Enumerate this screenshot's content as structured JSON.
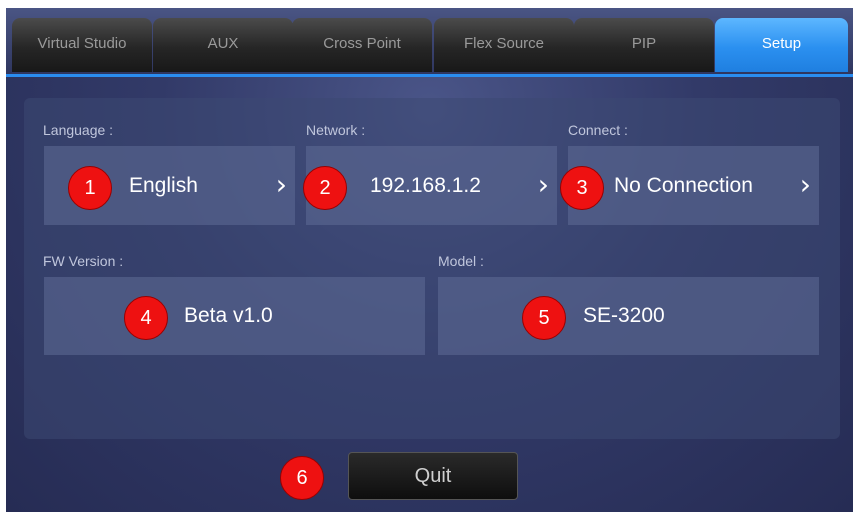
{
  "tabs": [
    {
      "label": "Virtual Studio"
    },
    {
      "label": "AUX"
    },
    {
      "label": "Cross Point"
    },
    {
      "label": "Flex Source"
    },
    {
      "label": "PIP"
    },
    {
      "label": "Setup"
    }
  ],
  "active_tab": "Setup",
  "settings": {
    "language": {
      "label": "Language :",
      "value": "English"
    },
    "network": {
      "label": "Network :",
      "value": "192.168.1.2"
    },
    "connect": {
      "label": "Connect :",
      "value": "No Connection"
    },
    "fw_version": {
      "label": "FW Version :",
      "value": "Beta v1.0"
    },
    "model": {
      "label": "Model :",
      "value": "SE-3200"
    }
  },
  "chevron_glyph": "›",
  "quit_label": "Quit",
  "callouts": [
    "1",
    "2",
    "3",
    "4",
    "5",
    "6"
  ],
  "colors": {
    "accent": "#2b90f0",
    "callout": "#ee1111",
    "background": "#323a68"
  }
}
